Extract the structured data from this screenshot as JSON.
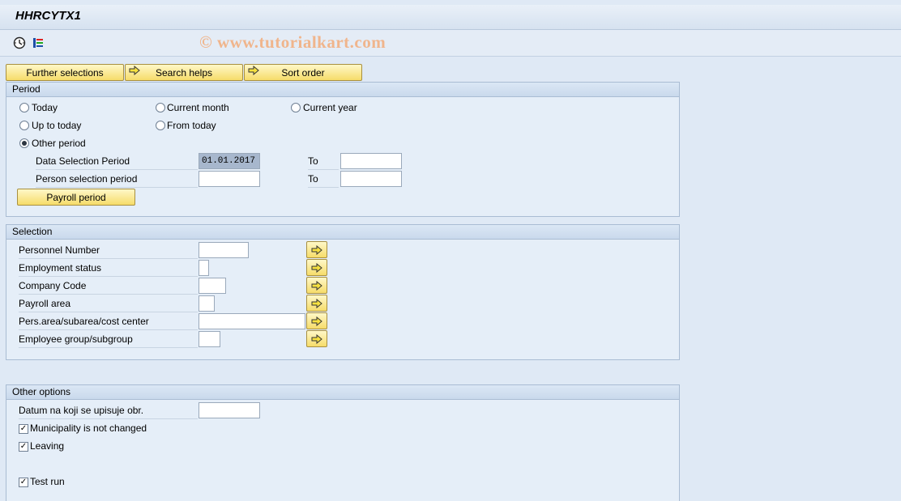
{
  "title": "HHRCYTX1",
  "watermark": "© www.tutorialkart.com",
  "toolbar": {
    "icons": [
      "execute-clock-icon",
      "variant-list-icon"
    ]
  },
  "tabs": {
    "further_selections": "Further selections",
    "search_helps": "Search helps",
    "sort_order": "Sort order"
  },
  "period": {
    "header": "Period",
    "radios": {
      "today": "Today",
      "current_month": "Current month",
      "current_year": "Current year",
      "up_to_today": "Up to today",
      "from_today": "From today",
      "other_period": "Other period"
    },
    "selected": "other_period",
    "data_selection_label": "Data Selection Period",
    "data_selection_from": "01.01.2017",
    "data_selection_to": "",
    "person_selection_label": "Person selection period",
    "person_selection_from": "",
    "person_selection_to": "",
    "to_label": "To",
    "payroll_button": "Payroll period"
  },
  "selection": {
    "header": "Selection",
    "fields": [
      {
        "label": "Personnel Number",
        "value": ""
      },
      {
        "label": "Employment status",
        "value": ""
      },
      {
        "label": "Company Code",
        "value": ""
      },
      {
        "label": "Payroll area",
        "value": ""
      },
      {
        "label": "Pers.area/subarea/cost center",
        "value": ""
      },
      {
        "label": "Employee group/subgroup",
        "value": ""
      }
    ]
  },
  "other_options": {
    "header": "Other options",
    "datum_label": "Datum na koji se upisuje obr.",
    "datum_value": "",
    "municipality_label": "Municipality is not changed",
    "municipality_checked": true,
    "leaving_label": "Leaving",
    "leaving_checked": true,
    "test_run_label": "Test run",
    "test_run_checked": true
  },
  "colors": {
    "background": "#dfe9f5",
    "button_yellow": "#f6dc6a",
    "watermark": "#f0b58c"
  }
}
